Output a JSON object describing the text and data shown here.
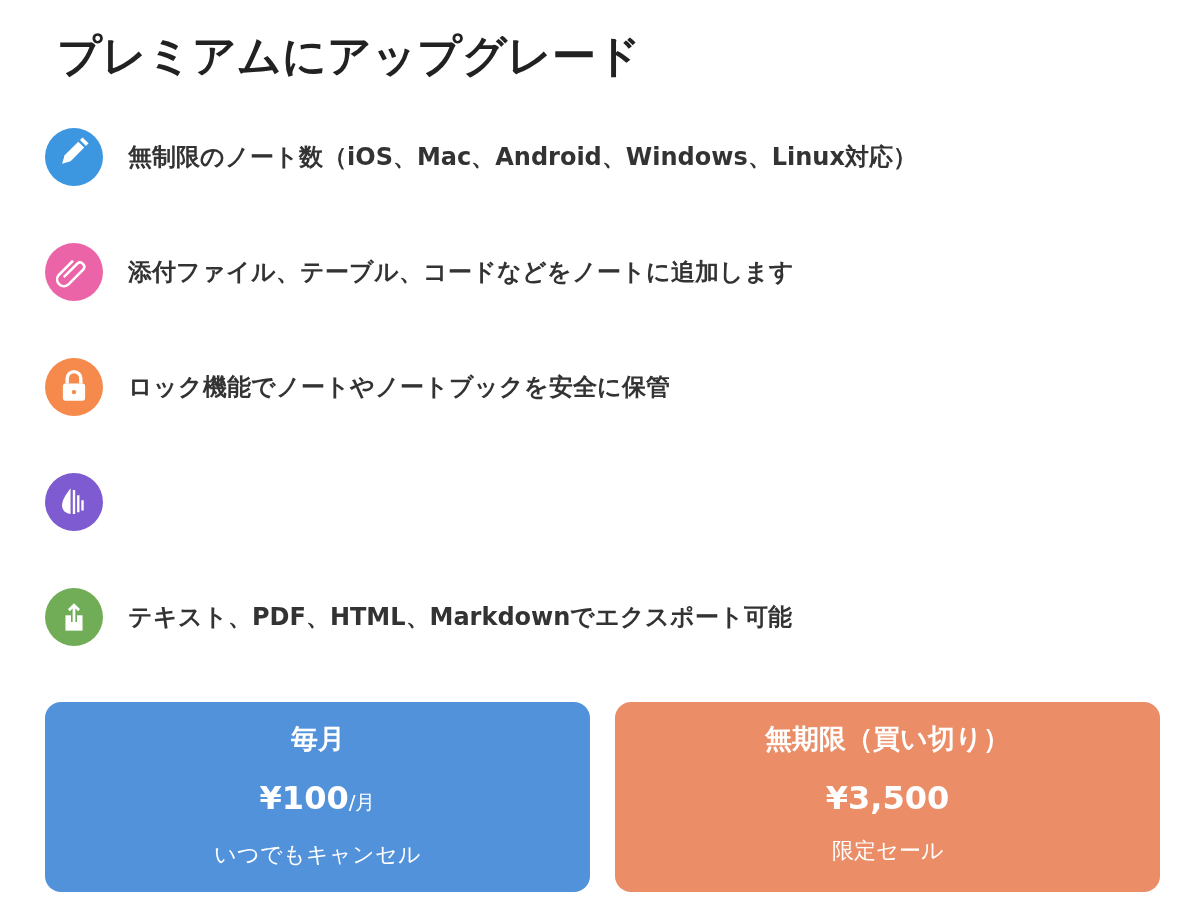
{
  "title": "プレミアムにアップグレード",
  "features": [
    {
      "color": "#3d96e0",
      "text": "無制限のノート数（iOS、Mac、Android、Windows、Linux対応）"
    },
    {
      "color": "#ec64a8",
      "text": "添付ファイル、テーブル、コードなどをノートに追加します"
    },
    {
      "color": "#f58a4c",
      "text": "ロック機能でノートやノートブックを安全に保管"
    },
    {
      "color": "#7e5bd0"
    },
    {
      "color": "#71ad57",
      "text": "テキスト、PDF、HTML、Markdownでエクスポート可能"
    }
  ],
  "plans": [
    {
      "name": "毎月",
      "price": "¥100",
      "unit": "/月",
      "note": "いつでもキャンセル",
      "color": "#5292db"
    },
    {
      "name": "無期限（買い切り）",
      "price": "¥3,500",
      "note": "限定セール",
      "color": "#eb8d67"
    }
  ]
}
